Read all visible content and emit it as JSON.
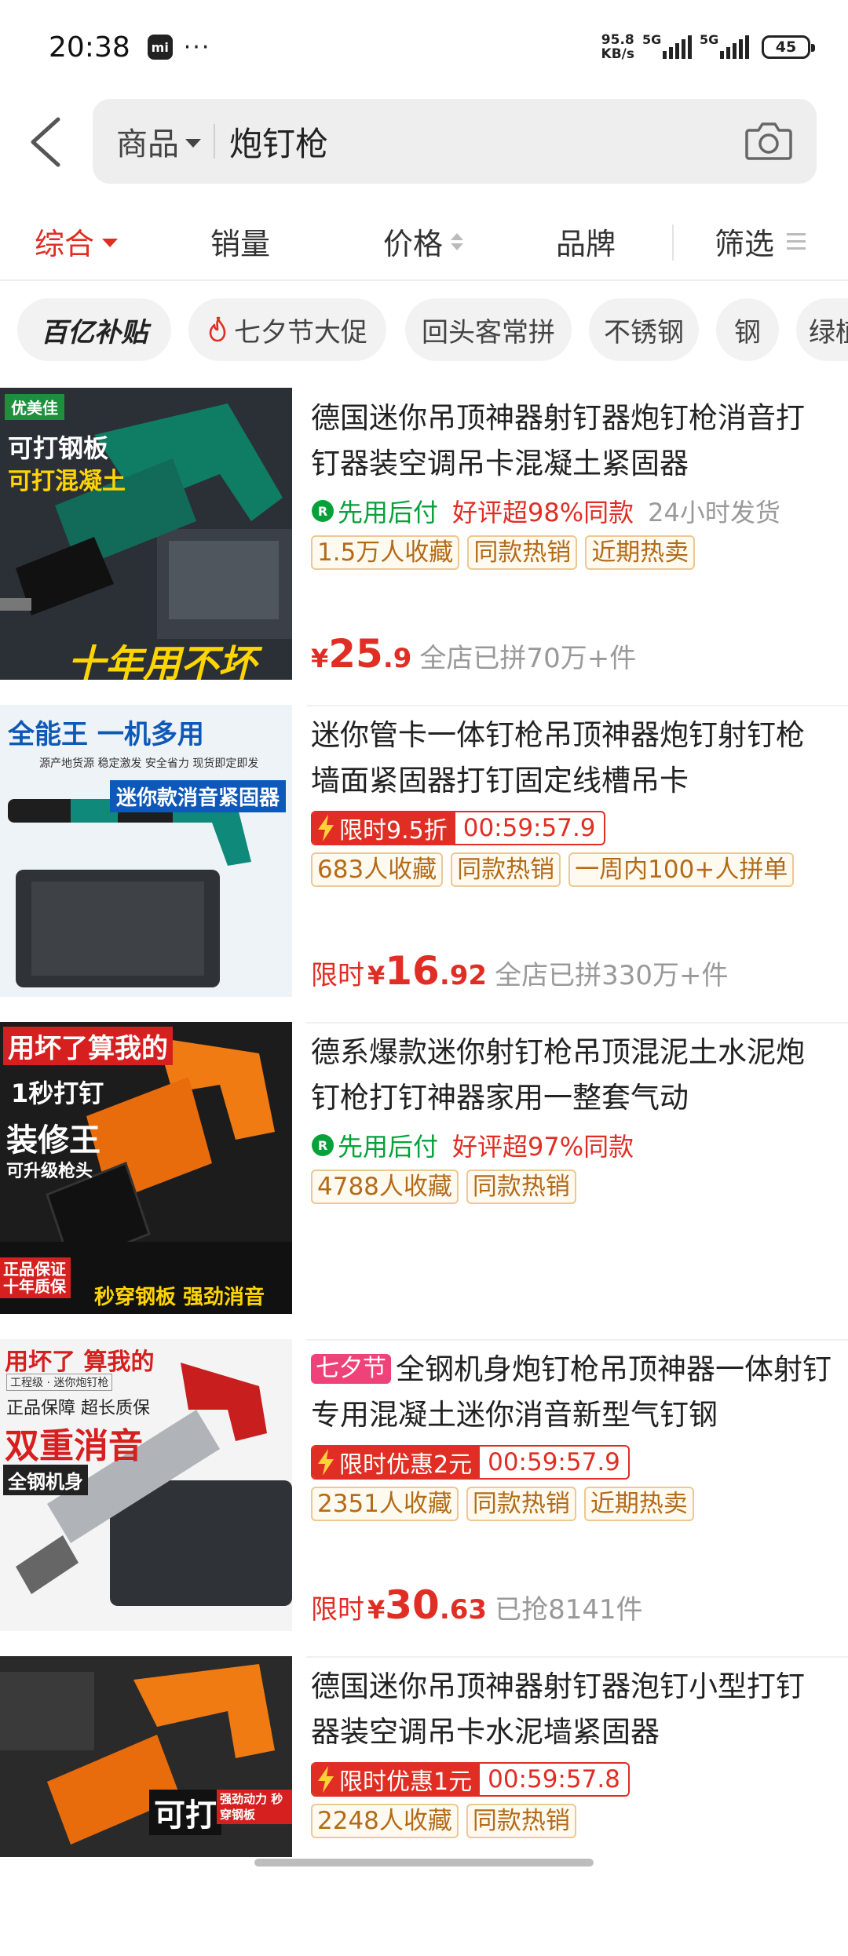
{
  "status": {
    "time": "20:38",
    "mi_badge": "mi",
    "dots": "···",
    "net_speed_value": "95.8",
    "net_speed_unit": "KB/s",
    "sim1": "5G",
    "sim2": "5G",
    "battery": "45"
  },
  "search": {
    "scope": "商品",
    "query": "炮钉枪"
  },
  "sort": {
    "composite": "综合",
    "sales": "销量",
    "price": "价格",
    "brand": "品牌",
    "filter": "筛选"
  },
  "chips": [
    "百亿补贴",
    "七夕节大促",
    "回头客常拼",
    "不锈钢",
    "钢",
    "绿植"
  ],
  "products": [
    {
      "title": "德国迷你吊顶神器射钉器炮钉枪消音打钉器装空调吊卡混凝土紧固器",
      "credit": "先用后付",
      "review": "好评超98%同款",
      "ship": "24小时发货",
      "badges": [
        "1.5万人收藏",
        "同款热销",
        "近期热卖"
      ],
      "price_prefix": "",
      "yen": "¥",
      "price_int": "25",
      "price_dec": ".9",
      "sales": "全店已拼70万+件",
      "thumb": {
        "line1": "可打钢板",
        "line2": "可打混凝土",
        "brand": "优美佳",
        "bottom": "十年用不坏"
      }
    },
    {
      "title": "迷你管卡一体钉枪吊顶神器炮钉射钉枪墙面紧固器打钉固定线槽吊卡",
      "promo": "限时9.5折",
      "timer": "00:59:57.9",
      "badges": [
        "683人收藏",
        "同款热销",
        "一周内100+人拼单"
      ],
      "price_prefix": "限时",
      "yen": "¥",
      "price_int": "16",
      "price_dec": ".92",
      "sales": "全店已拼330万+件",
      "thumb": {
        "headline": "全能王 一机多用",
        "sub": "源产地货源  稳定激发  安全省力  现货即定即发",
        "ribbon": "迷你款消音紧固器"
      }
    },
    {
      "title": "德系爆款迷你射钉枪吊顶混泥土水泥炮钉枪打钉神器家用一整套气动",
      "credit": "先用后付",
      "review": "好评超97%同款",
      "badges": [
        "4788人收藏",
        "同款热销"
      ],
      "thumb": {
        "line1": "用坏了算我的",
        "line2": "1秒打钉",
        "line3": "装修王",
        "line4": "可升级枪头",
        "guarantee": "正品保证 十年质保",
        "bottom": "秒穿钢板 强劲消音"
      }
    },
    {
      "fest_tag": "七夕节",
      "title": "全钢机身炮钉枪吊顶神器一体射钉专用混凝土迷你消音新型气钉钢",
      "promo": "限时优惠2元",
      "timer": "00:59:57.9",
      "badges": [
        "2351人收藏",
        "同款热销",
        "近期热卖"
      ],
      "price_prefix": "限时",
      "yen": "¥",
      "price_int": "30",
      "price_dec": ".63",
      "sales": "已抢8141件",
      "thumb": {
        "line1": "用坏了 算我的",
        "line2": "工程级 · 迷你炮钉枪",
        "line3": "正品保障 超长质保",
        "line4": "双重消音",
        "line5": "全钢机身"
      }
    },
    {
      "title": "德国迷你吊顶神器射钉器泡钉小型打钉器装空调吊卡水泥墙紧固器",
      "promo": "限时优惠1元",
      "timer": "00:59:57.8",
      "badges": [
        "2248人收藏",
        "同款热销"
      ],
      "thumb": {
        "line1": "可打",
        "line2": "强劲动力 秒穿钢板"
      }
    }
  ],
  "colors": {
    "accent": "#e02e24",
    "credit_green": "#07a13a",
    "badge_text": "#b36b18",
    "badge_border": "#ecc893",
    "festival_pink": "#f0427a"
  },
  "icons": {
    "back": "chevron-left-icon",
    "camera": "camera-icon",
    "fire": "fire-icon",
    "credit": "shield-check-icon",
    "bolt": "lightning-icon"
  }
}
